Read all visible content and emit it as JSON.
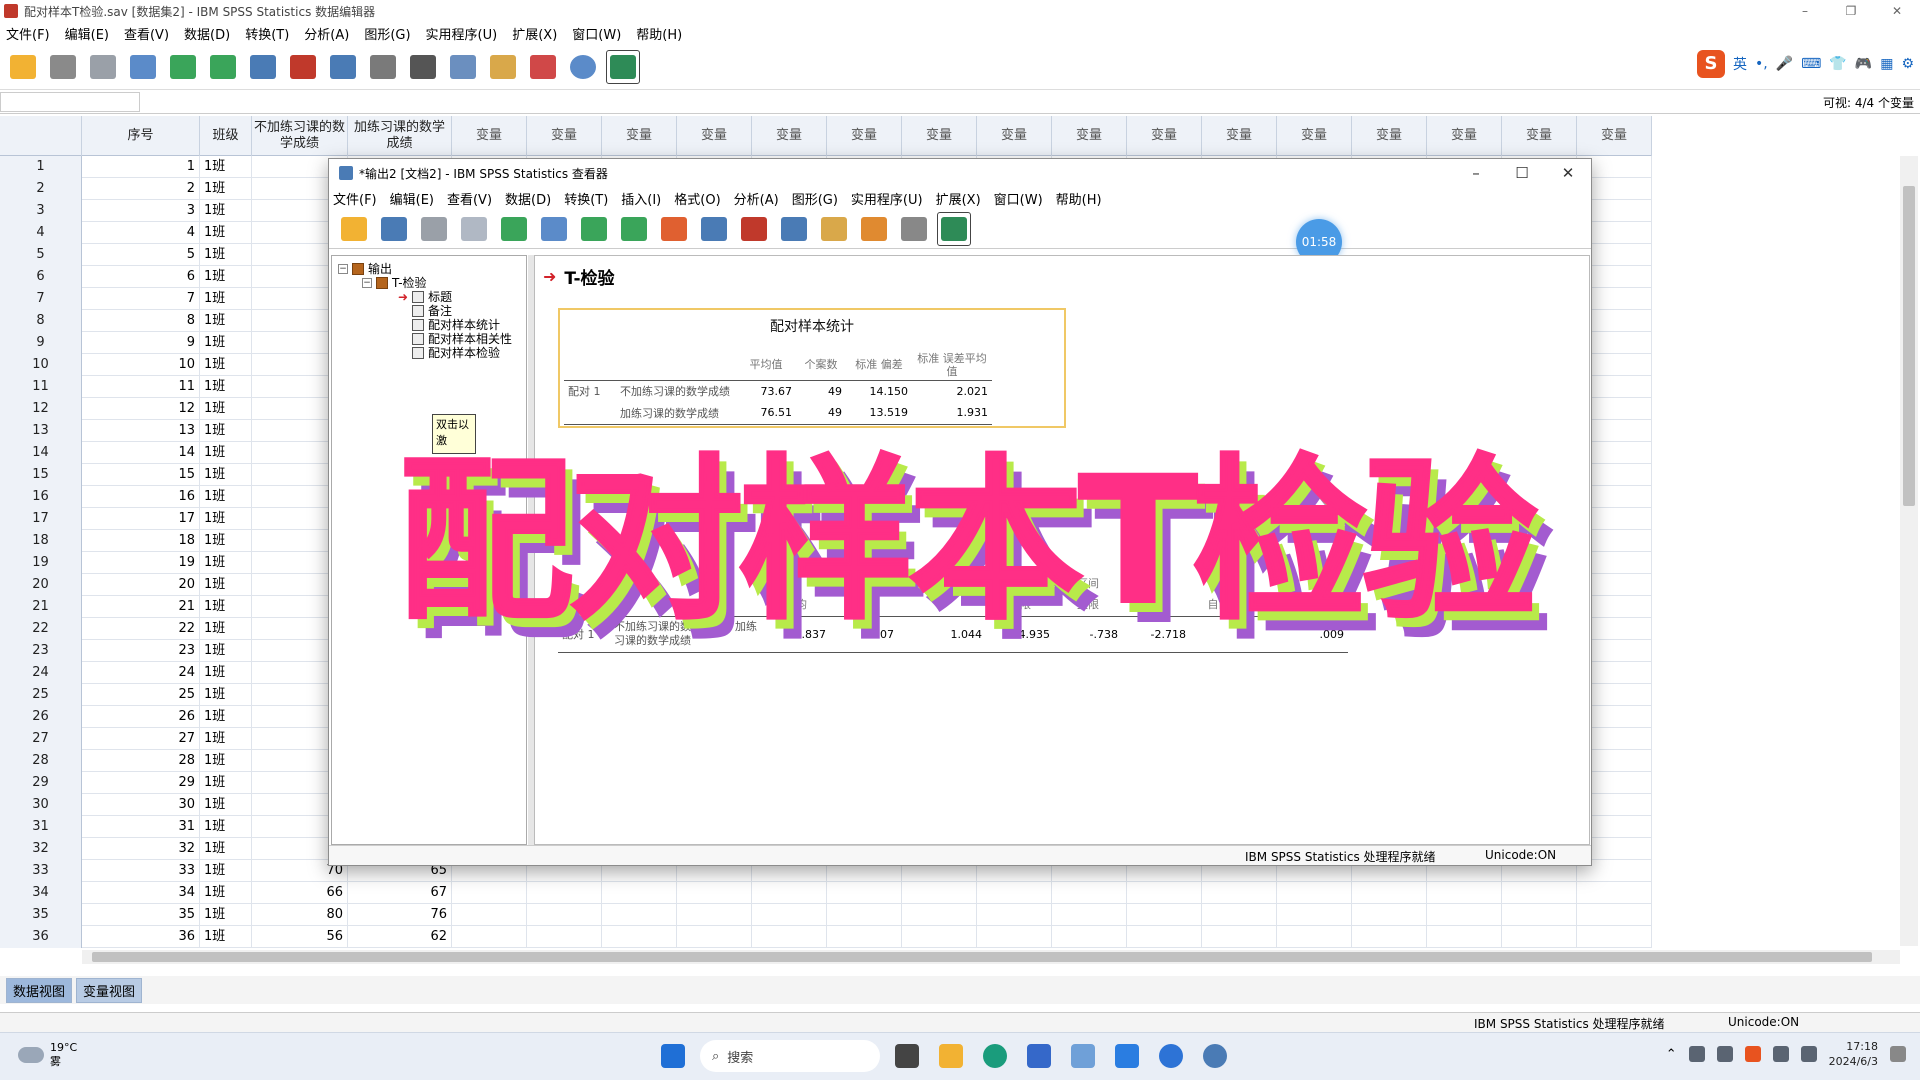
{
  "window": {
    "title": "配对样本T检验.sav [数据集2] - IBM SPSS Statistics 数据编辑器",
    "controls": [
      "–",
      "❐",
      "✕"
    ]
  },
  "menu": [
    "文件(F)",
    "编辑(E)",
    "查看(V)",
    "数据(D)",
    "转换(T)",
    "分析(A)",
    "图形(G)",
    "实用程序(U)",
    "扩展(X)",
    "窗口(W)",
    "帮助(H)"
  ],
  "ime": {
    "logo": "S",
    "lang": "英"
  },
  "cellbar": {
    "visible": "可视: 4/4 个变量"
  },
  "grid": {
    "columns": [
      "序号",
      "班级",
      "不加练习课的数学成绩",
      "加练习课的数学成绩"
    ],
    "var_label": "变量",
    "var_count": 16,
    "rows": [
      [
        "1",
        "1班",
        "",
        ""
      ],
      [
        "2",
        "1班",
        "",
        ""
      ],
      [
        "3",
        "1班",
        "",
        ""
      ],
      [
        "4",
        "1班",
        "",
        ""
      ],
      [
        "5",
        "1班",
        "",
        ""
      ],
      [
        "6",
        "1班",
        "",
        ""
      ],
      [
        "7",
        "1班",
        "",
        ""
      ],
      [
        "8",
        "1班",
        "",
        ""
      ],
      [
        "9",
        "1班",
        "",
        ""
      ],
      [
        "10",
        "1班",
        "",
        ""
      ],
      [
        "11",
        "1班",
        "",
        ""
      ],
      [
        "12",
        "1班",
        "",
        ""
      ],
      [
        "13",
        "1班",
        "",
        ""
      ],
      [
        "14",
        "1班",
        "",
        ""
      ],
      [
        "15",
        "1班",
        "",
        ""
      ],
      [
        "16",
        "1班",
        "",
        ""
      ],
      [
        "17",
        "1班",
        "",
        ""
      ],
      [
        "18",
        "1班",
        "",
        ""
      ],
      [
        "19",
        "1班",
        "",
        ""
      ],
      [
        "20",
        "1班",
        "",
        ""
      ],
      [
        "21",
        "1班",
        "",
        ""
      ],
      [
        "22",
        "1班",
        "",
        ""
      ],
      [
        "23",
        "1班",
        "",
        ""
      ],
      [
        "24",
        "1班",
        "",
        ""
      ],
      [
        "25",
        "1班",
        "",
        ""
      ],
      [
        "26",
        "1班",
        "",
        ""
      ],
      [
        "27",
        "1班",
        "",
        ""
      ],
      [
        "28",
        "1班",
        "",
        ""
      ],
      [
        "29",
        "1班",
        "",
        ""
      ],
      [
        "30",
        "1班",
        "",
        ""
      ],
      [
        "31",
        "1班",
        "",
        ""
      ],
      [
        "32",
        "1班",
        "",
        ""
      ],
      [
        "33",
        "1班",
        "70",
        "65"
      ],
      [
        "34",
        "1班",
        "66",
        "67"
      ],
      [
        "35",
        "1班",
        "80",
        "76"
      ],
      [
        "36",
        "1班",
        "56",
        "62"
      ]
    ]
  },
  "viewtabs": {
    "data_view": "数据视图",
    "var_view": "变量视图"
  },
  "status": {
    "processor": "IBM SPSS Statistics 处理程序就绪",
    "unicode": "Unicode:ON"
  },
  "viewer": {
    "title": "*输出2 [文档2] - IBM SPSS Statistics 查看器",
    "menu": [
      "文件(F)",
      "编辑(E)",
      "查看(V)",
      "数据(D)",
      "转换(T)",
      "插入(I)",
      "格式(O)",
      "分析(A)",
      "图形(G)",
      "实用程序(U)",
      "扩展(X)",
      "窗口(W)",
      "帮助(H)"
    ],
    "timer": "01:58",
    "outline": {
      "root": "输出",
      "test": "T-检验",
      "items": [
        "标题",
        "备注",
        "配对样本统计",
        "配对样本相关性",
        "配对样本检验"
      ]
    },
    "section_title": "T-检验",
    "paired_stats": {
      "caption": "配对样本统计",
      "headers": [
        "平均值",
        "个案数",
        "标准 偏差",
        "标准 误差平均值"
      ],
      "pair_label": "配对 1",
      "rows": [
        {
          "name": "不加练习课的数学成绩",
          "mean": "73.67",
          "n": "49",
          "sd": "14.150",
          "se": "2.021"
        },
        {
          "name": "加练习课的数学成绩",
          "mean": "76.51",
          "n": "49",
          "sd": "13.519",
          "se": "1.931"
        }
      ]
    },
    "tooltip": "双击以\n激",
    "paired_test": {
      "headers": [
        "平均",
        "偏差",
        "",
        "下限",
        "上限",
        "t",
        "自由度",
        ""
      ],
      "headers_partial": [
        "区间"
      ],
      "pair_label": "配对 1",
      "row_name": "不加练习课的数学成绩 - 加练习课的数学成绩",
      "values": [
        "-2.837",
        "7.307",
        "1.044",
        "-4.935",
        "-.738",
        "-2.718",
        "48",
        ".009"
      ]
    },
    "status": {
      "processor": "IBM SPSS Statistics 处理程序就绪",
      "unicode": "Unicode:ON"
    }
  },
  "banner": {
    "text": "配对样本T检验"
  },
  "taskbar": {
    "weather": {
      "temp": "19°C",
      "desc": "雾"
    },
    "search": "搜索",
    "time": "17:18",
    "date": "2024/6/3"
  }
}
